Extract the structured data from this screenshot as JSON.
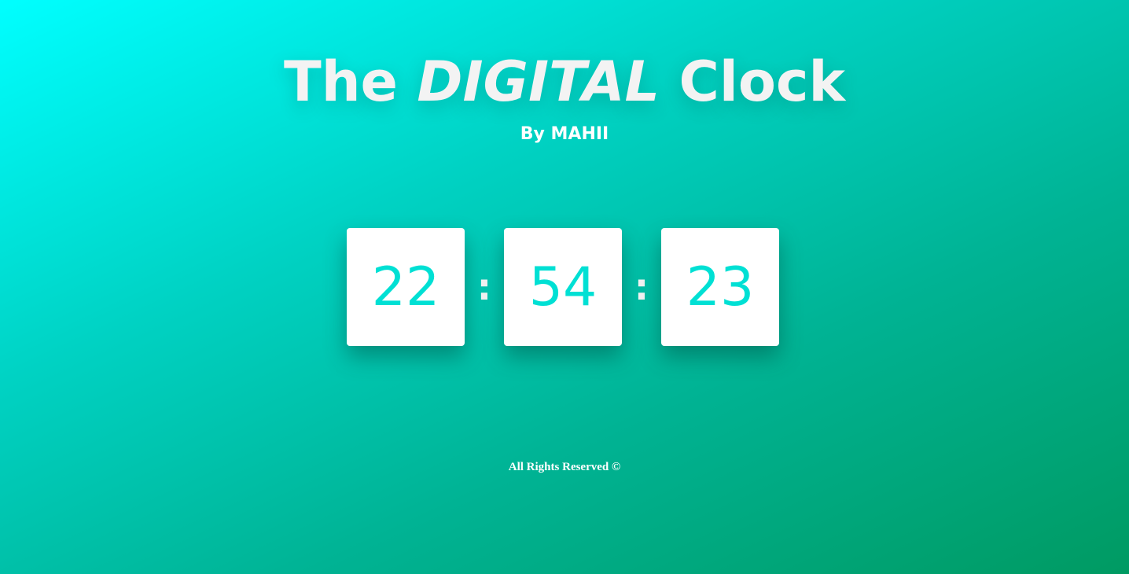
{
  "header": {
    "title_prefix": "The",
    "title_emphasis": "DIGITAL",
    "title_suffix": "Clock",
    "subtitle": "By MAHII"
  },
  "clock": {
    "hours": "22",
    "minutes": "54",
    "seconds": "23",
    "separator": ":"
  },
  "footer": {
    "text": "All Rights Reserved ©"
  },
  "colors": {
    "digit": "#00e0d4",
    "gradient_start": "#00ffff",
    "gradient_end": "#009a62"
  }
}
